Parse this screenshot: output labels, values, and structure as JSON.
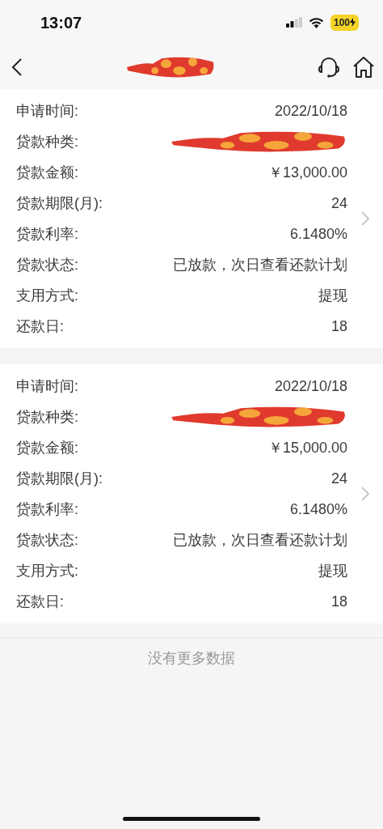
{
  "status_bar": {
    "time": "13:07",
    "battery": "100"
  },
  "header": {
    "title_redacted": true
  },
  "loans": [
    {
      "rows": [
        {
          "kind": "text",
          "label": "申请时间:",
          "value": "2022/10/18"
        },
        {
          "kind": "redacted",
          "label": "贷款种类:"
        },
        {
          "kind": "text",
          "label": "贷款金额:",
          "value": "￥13,000.00"
        },
        {
          "kind": "text",
          "label": "贷款期限(月):",
          "value": "24"
        },
        {
          "kind": "text",
          "label": "贷款利率:",
          "value": "6.1480%"
        },
        {
          "kind": "text",
          "label": "贷款状态:",
          "value": "已放款，次日查看还款计划"
        },
        {
          "kind": "text",
          "label": "支用方式:",
          "value": "提现"
        },
        {
          "kind": "text",
          "label": "还款日:",
          "value": "18"
        }
      ]
    },
    {
      "rows": [
        {
          "kind": "text",
          "label": "申请时间:",
          "value": "2022/10/18"
        },
        {
          "kind": "redacted",
          "label": "贷款种类:"
        },
        {
          "kind": "text",
          "label": "贷款金额:",
          "value": "￥15,000.00"
        },
        {
          "kind": "text",
          "label": "贷款期限(月):",
          "value": "24"
        },
        {
          "kind": "text",
          "label": "贷款利率:",
          "value": "6.1480%"
        },
        {
          "kind": "text",
          "label": "贷款状态:",
          "value": "已放款，次日查看还款计划"
        },
        {
          "kind": "text",
          "label": "支用方式:",
          "value": "提现"
        },
        {
          "kind": "text",
          "label": "还款日:",
          "value": "18"
        }
      ]
    }
  ],
  "footer": {
    "text": "没有更多数据"
  }
}
